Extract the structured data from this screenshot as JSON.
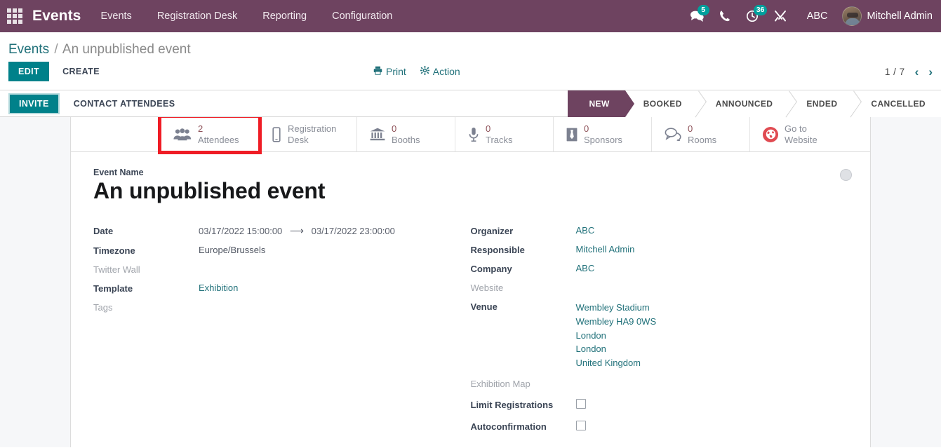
{
  "navbar": {
    "apps_icon": "apps-grid-icon",
    "brand": "Events",
    "menu": [
      {
        "label": "Events"
      },
      {
        "label": "Registration Desk"
      },
      {
        "label": "Reporting"
      },
      {
        "label": "Configuration"
      }
    ],
    "messages_badge": "5",
    "activities_badge": "36",
    "company": "ABC",
    "user": "Mitchell Admin",
    "accent_color": "#6E4360"
  },
  "control_panel": {
    "breadcrumb_root": "Events",
    "breadcrumb_sep": "/",
    "breadcrumb_current": "An unpublished event",
    "edit_label": "EDIT",
    "create_label": "CREATE",
    "print_label": "Print",
    "action_label": "Action",
    "pager": "1 / 7",
    "prev_arrow": "‹",
    "next_arrow": "›"
  },
  "status_row": {
    "invite_label": "INVITE",
    "contact_label": "CONTACT ATTENDEES",
    "stages": [
      {
        "label": "NEW",
        "active": true
      },
      {
        "label": "BOOKED",
        "active": false
      },
      {
        "label": "ANNOUNCED",
        "active": false
      },
      {
        "label": "ENDED",
        "active": false
      },
      {
        "label": "CANCELLED",
        "active": false
      }
    ]
  },
  "smart_buttons": [
    {
      "count": "2",
      "label": "Attendees",
      "icon": "users-icon",
      "highlighted": true
    },
    {
      "count": "",
      "label": "Registration\nDesk",
      "icon": "mobile-icon",
      "highlighted": false
    },
    {
      "count": "0",
      "label": "Booths",
      "icon": "bank-icon",
      "highlighted": false
    },
    {
      "count": "0",
      "label": "Tracks",
      "icon": "microphone-icon",
      "highlighted": false
    },
    {
      "count": "0",
      "label": "Sponsors",
      "icon": "tie-icon",
      "highlighted": false
    },
    {
      "count": "0",
      "label": "Rooms",
      "icon": "comments-icon",
      "highlighted": false
    },
    {
      "count": "",
      "label": "Go to\nWebsite",
      "icon": "globe-icon",
      "highlighted": false
    }
  ],
  "form": {
    "event_name_label": "Event Name",
    "event_name": "An unpublished event",
    "left": {
      "date_label": "Date",
      "date_start": "03/17/2022 15:00:00",
      "date_arrow": "⟶",
      "date_end": "03/17/2022 23:00:00",
      "timezone_label": "Timezone",
      "timezone": "Europe/Brussels",
      "twitter_wall_label": "Twitter Wall",
      "twitter_wall": "",
      "template_label": "Template",
      "template": "Exhibition",
      "tags_label": "Tags",
      "tags": ""
    },
    "right": {
      "organizer_label": "Organizer",
      "organizer": "ABC",
      "responsible_label": "Responsible",
      "responsible": "Mitchell Admin",
      "company_label": "Company",
      "company": "ABC",
      "website_label": "Website",
      "website": "",
      "venue_label": "Venue",
      "venue_lines": [
        "Wembley Stadium",
        "Wembley HA9 0WS",
        "London",
        "London",
        "United Kingdom"
      ],
      "exhibition_map_label": "Exhibition Map",
      "exhibition_map": "",
      "limit_registrations_label": "Limit Registrations",
      "limit_registrations_checked": false,
      "autoconfirmation_label": "Autoconfirmation",
      "autoconfirmation_checked": false
    }
  },
  "annotation": {
    "highlight_color": "#ef1c25",
    "target": "Attendees smart button"
  }
}
